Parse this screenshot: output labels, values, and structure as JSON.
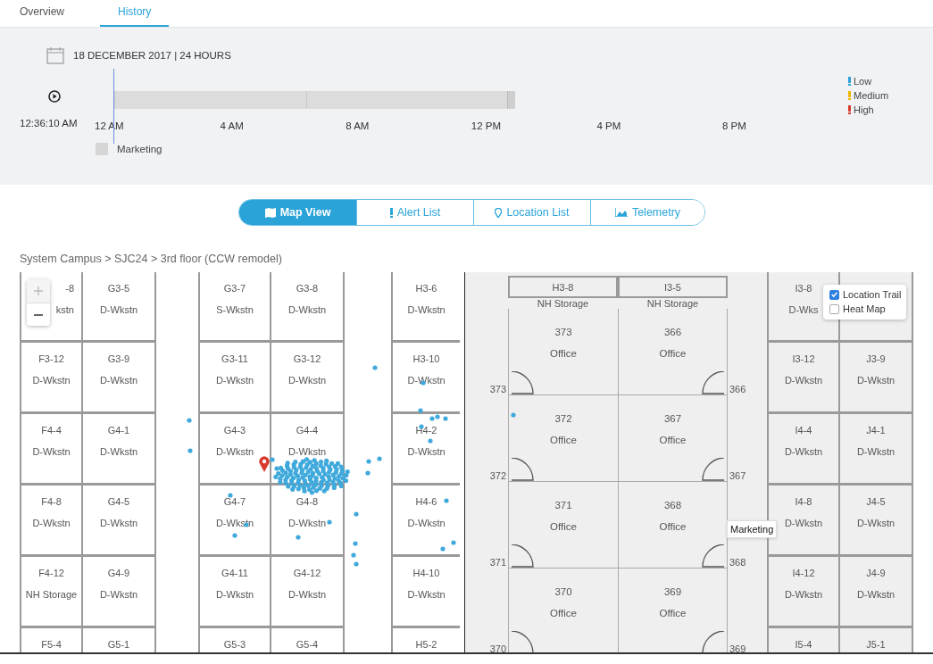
{
  "tabs": [
    {
      "label": "Overview",
      "selected": false
    },
    {
      "label": "History",
      "selected": true
    }
  ],
  "timeline": {
    "date": "18 DECEMBER 2017 | 24 HOURS",
    "current_time": "12:36:10 AM",
    "hour_labels": [
      "12 AM",
      "4 AM",
      "8 AM",
      "12 PM",
      "4 PM",
      "8 PM"
    ],
    "groups": [
      {
        "label": "Marketing"
      }
    ]
  },
  "severity_legend": [
    {
      "label": "Low",
      "color": "#2f9fd8"
    },
    {
      "label": "Medium",
      "color": "#f2b600"
    },
    {
      "label": "High",
      "color": "#d8392d"
    }
  ],
  "view_switch": [
    {
      "label": "Map View",
      "kind": "map",
      "selected": true
    },
    {
      "label": "Alert List",
      "kind": "alert",
      "selected": false
    },
    {
      "label": "Location List",
      "kind": "pin",
      "selected": false
    },
    {
      "label": "Telemetry",
      "kind": "chart",
      "selected": false
    }
  ],
  "breadcrumb": "System Campus > SJC24 > 3rd floor (CCW remodel)",
  "map": {
    "blocks": [
      {
        "kind": "cubicles",
        "columns": [
          [
            {
              "code": "-8",
              "type": "kstn"
            },
            {
              "code": "F3-12",
              "type": "D-Wkstn"
            },
            {
              "code": "F4-4",
              "type": "D-Wkstn"
            },
            {
              "code": "F4-8",
              "type": "D-Wkstn"
            },
            {
              "code": "F4-12",
              "type": "NH Storage"
            },
            {
              "code": "F5-4"
            }
          ],
          [
            {
              "code": "G3-5",
              "type": "D-Wkstn"
            },
            {
              "code": "G3-9",
              "type": "D-Wkstn"
            },
            {
              "code": "G4-1",
              "type": "D-Wkstn"
            },
            {
              "code": "G4-5",
              "type": "D-Wkstn"
            },
            {
              "code": "G4-9",
              "type": "D-Wkstn"
            },
            {
              "code": "G5-1"
            }
          ]
        ]
      },
      {
        "kind": "cubicles",
        "columns": [
          [
            {
              "code": "G3-7",
              "type": "S-Wkstn"
            },
            {
              "code": "G3-11",
              "type": "D-Wkstn"
            },
            {
              "code": "G4-3",
              "type": "D-Wkstn"
            },
            {
              "code": "G4-7",
              "type": "D-Wkstn"
            },
            {
              "code": "G4-11",
              "type": "D-Wkstn"
            },
            {
              "code": "G5-3"
            }
          ],
          [
            {
              "code": "G3-8",
              "type": "D-Wkstn"
            },
            {
              "code": "G3-12",
              "type": "D-Wkstn"
            },
            {
              "code": "G4-4",
              "type": "D-Wkstn"
            },
            {
              "code": "G4-8",
              "type": "D-Wkstn"
            },
            {
              "code": "G4-12",
              "type": "D-Wkstn"
            },
            {
              "code": "G5-4"
            }
          ]
        ]
      },
      {
        "kind": "cubicles",
        "columns": [
          [
            {
              "code": "H3-6",
              "type": "D-Wkstn"
            },
            {
              "code": "H3-10",
              "type": "D-Wkstn"
            },
            {
              "code": "H4-2",
              "type": "D-Wkstn"
            },
            {
              "code": "H4-6",
              "type": "D-Wkstn"
            },
            {
              "code": "H4-10",
              "type": "D-Wkstn"
            },
            {
              "code": "H5-2"
            }
          ]
        ]
      },
      {
        "kind": "offices",
        "storage": [
          {
            "code": "H3-8",
            "type": "NH Storage"
          },
          {
            "code": "I3-5",
            "type": "NH Storage"
          }
        ],
        "rows": [
          [
            {
              "number": "373",
              "name": "Office",
              "door": "373"
            },
            {
              "number": "366",
              "name": "Office",
              "door": "366"
            }
          ],
          [
            {
              "number": "372",
              "name": "Office",
              "door": "372"
            },
            {
              "number": "367",
              "name": "Office",
              "door": "367"
            }
          ],
          [
            {
              "number": "371",
              "name": "Office",
              "door": "371"
            },
            {
              "number": "368",
              "name": "Office",
              "door": "368"
            }
          ],
          [
            {
              "number": "370",
              "name": "Office",
              "door": "370"
            },
            {
              "number": "369",
              "name": "Office",
              "door": "369"
            }
          ]
        ]
      },
      {
        "kind": "cubicles",
        "columns": [
          [
            {
              "code": "I3-8",
              "type": "D-Wks"
            },
            {
              "code": "I3-12",
              "type": "D-Wkstn"
            },
            {
              "code": "I4-4",
              "type": "D-Wkstn"
            },
            {
              "code": "I4-8",
              "type": "D-Wkstn"
            },
            {
              "code": "I4-12",
              "type": "D-Wkstn"
            },
            {
              "code": "I5-4"
            }
          ],
          [
            {
              "code": "J3-9",
              "type": "D-Wkstn"
            },
            {
              "code": "J4-1",
              "type": "D-Wkstn"
            },
            {
              "code": "J4-5",
              "type": "D-Wkstn"
            },
            {
              "code": "J4-9",
              "type": "D-Wkstn"
            },
            {
              "code": "J5-1"
            }
          ]
        ]
      }
    ],
    "layers": [
      {
        "label": "Location Trail",
        "checked": true
      },
      {
        "label": "Heat Map",
        "checked": false
      }
    ],
    "tooltip": "Marketing"
  }
}
